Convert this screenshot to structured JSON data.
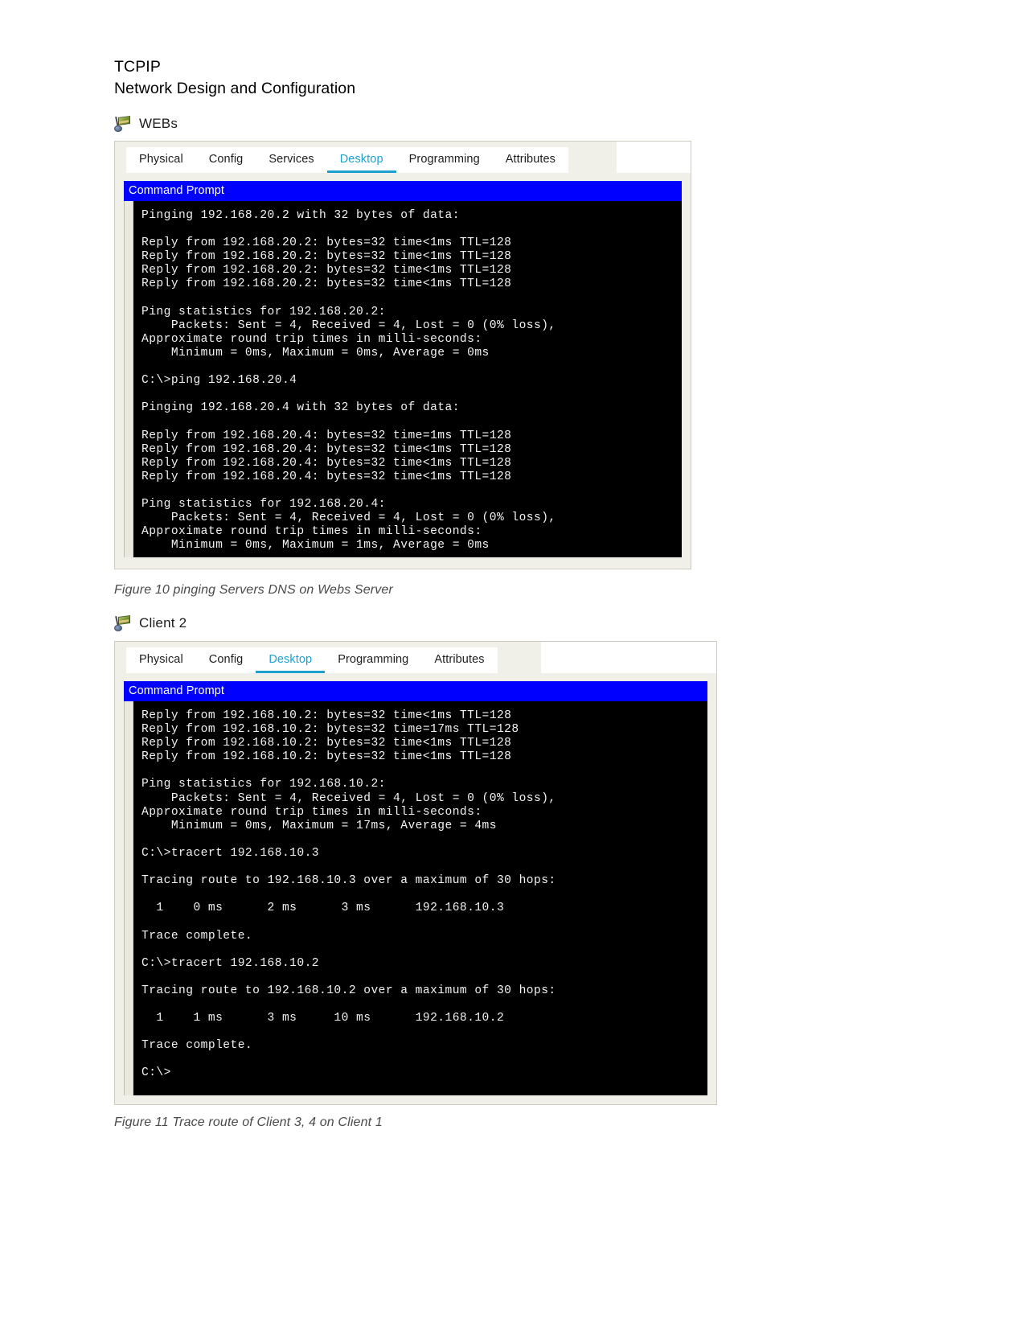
{
  "document": {
    "heading_line1": "TCPIP",
    "heading_line2": "Network Design and Configuration"
  },
  "figure10": {
    "device_label": "WEBs",
    "device_icon": "packet-tracer-device-icon",
    "tabs": [
      {
        "label": "Physical",
        "active": false
      },
      {
        "label": "Config",
        "active": false
      },
      {
        "label": "Services",
        "active": false
      },
      {
        "label": "Desktop",
        "active": true
      },
      {
        "label": "Programming",
        "active": false
      },
      {
        "label": "Attributes",
        "active": false
      }
    ],
    "command_prompt_title": "Command Prompt",
    "terminal_text": "Pinging 192.168.20.2 with 32 bytes of data:\n\nReply from 192.168.20.2: bytes=32 time<1ms TTL=128\nReply from 192.168.20.2: bytes=32 time<1ms TTL=128\nReply from 192.168.20.2: bytes=32 time<1ms TTL=128\nReply from 192.168.20.2: bytes=32 time<1ms TTL=128\n\nPing statistics for 192.168.20.2:\n    Packets: Sent = 4, Received = 4, Lost = 0 (0% loss),\nApproximate round trip times in milli-seconds:\n    Minimum = 0ms, Maximum = 0ms, Average = 0ms\n\nC:\\>ping 192.168.20.4\n\nPinging 192.168.20.4 with 32 bytes of data:\n\nReply from 192.168.20.4: bytes=32 time=1ms TTL=128\nReply from 192.168.20.4: bytes=32 time<1ms TTL=128\nReply from 192.168.20.4: bytes=32 time<1ms TTL=128\nReply from 192.168.20.4: bytes=32 time<1ms TTL=128\n\nPing statistics for 192.168.20.4:\n    Packets: Sent = 4, Received = 4, Lost = 0 (0% loss),\nApproximate round trip times in milli-seconds:\n    Minimum = 0ms, Maximum = 1ms, Average = 0ms",
    "caption": "Figure 10 pinging Servers DNS on Webs Server"
  },
  "figure11": {
    "device_label": "Client 2",
    "device_icon": "packet-tracer-device-icon",
    "tabs": [
      {
        "label": "Physical",
        "active": false
      },
      {
        "label": "Config",
        "active": false
      },
      {
        "label": "Desktop",
        "active": true
      },
      {
        "label": "Programming",
        "active": false
      },
      {
        "label": "Attributes",
        "active": false
      }
    ],
    "command_prompt_title": "Command Prompt",
    "terminal_text": "Reply from 192.168.10.2: bytes=32 time<1ms TTL=128\nReply from 192.168.10.2: bytes=32 time=17ms TTL=128\nReply from 192.168.10.2: bytes=32 time<1ms TTL=128\nReply from 192.168.10.2: bytes=32 time<1ms TTL=128\n\nPing statistics for 192.168.10.2:\n    Packets: Sent = 4, Received = 4, Lost = 0 (0% loss),\nApproximate round trip times in milli-seconds:\n    Minimum = 0ms, Maximum = 17ms, Average = 4ms\n\nC:\\>tracert 192.168.10.3\n\nTracing route to 192.168.10.3 over a maximum of 30 hops:\n\n  1    0 ms      2 ms      3 ms      192.168.10.3\n\nTrace complete.\n\nC:\\>tracert 192.168.10.2\n\nTracing route to 192.168.10.2 over a maximum of 30 hops:\n\n  1    1 ms      3 ms     10 ms      192.168.10.2\n\nTrace complete.\n\nC:\\>",
    "caption": "Figure 11 Trace route of Client 3, 4 on Client 1"
  },
  "colors": {
    "active_tab": "#1da0d0",
    "command_prompt_bar": "#0000ff",
    "terminal_bg": "#000000",
    "terminal_fg": "#f2f2f2",
    "window_chrome": "#f0efe8"
  }
}
